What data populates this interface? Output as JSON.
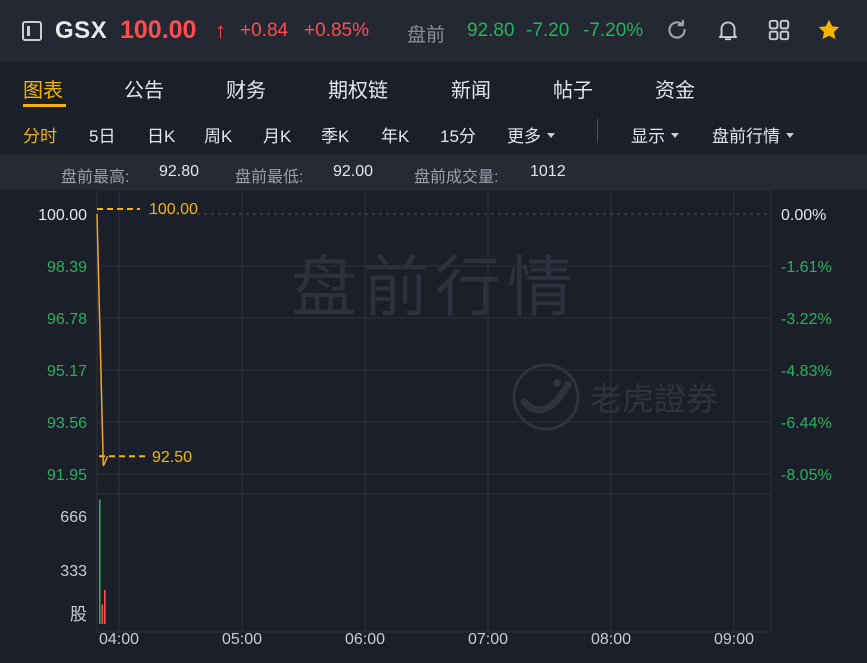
{
  "header": {
    "ticker": "GSX",
    "price": "100.00",
    "price_arrow": "↑",
    "change": "+0.84",
    "change_pct": "+0.85%",
    "premarket_label": "盘前",
    "premarket_price": "92.80",
    "premarket_change": "-7.20",
    "premarket_change_pct": "-7.20%",
    "icons": [
      "sidebar-toggle-icon",
      "refresh-icon",
      "bell-icon",
      "grid-icon",
      "star-icon"
    ]
  },
  "tabs": [
    {
      "label": "图表",
      "active": true
    },
    {
      "label": "公告"
    },
    {
      "label": "财务"
    },
    {
      "label": "期权链"
    },
    {
      "label": "新闻"
    },
    {
      "label": "帖子"
    },
    {
      "label": "资金"
    }
  ],
  "periods": [
    {
      "label": "分时",
      "active": true
    },
    {
      "label": "5日"
    },
    {
      "label": "日K"
    },
    {
      "label": "周K"
    },
    {
      "label": "月K"
    },
    {
      "label": "季K"
    },
    {
      "label": "年K"
    },
    {
      "label": "15分"
    },
    {
      "label": "更多"
    }
  ],
  "display_dropdown": "显示",
  "session_dropdown": "盘前行情",
  "info": {
    "high_label": "盘前最高:",
    "high_value": "92.80",
    "low_label": "盘前最低:",
    "low_value": "92.00",
    "volume_label": "盘前成交量:",
    "volume_value": "1012"
  },
  "watermark": {
    "text": "盘前行情",
    "brand": "老虎證券"
  },
  "colors": {
    "up": "#ff4d4f",
    "down": "#24b35b",
    "accent": "#f4b400",
    "price_line": "#f5a623"
  },
  "chart_data": {
    "type": "line",
    "y_ticks": [
      "100.00",
      "98.39",
      "96.78",
      "95.17",
      "93.56",
      "91.95"
    ],
    "pct_ticks": [
      "0.00%",
      "-1.61%",
      "-3.22%",
      "-4.83%",
      "-6.44%",
      "-8.05%"
    ],
    "ylim": [
      91.95,
      100.0
    ],
    "x_ticks": [
      "04:00",
      "05:00",
      "06:00",
      "07:00",
      "08:00",
      "09:00"
    ],
    "reference_line": {
      "label": "100.00",
      "value": 100.0
    },
    "last_price_line": {
      "label": "92.50",
      "value": 92.5
    },
    "series": [
      {
        "x": [
          "04:00",
          "04:02",
          "04:03"
        ],
        "values": [
          100.0,
          92.2,
          92.5
        ]
      }
    ],
    "volume": {
      "ticks": [
        "666",
        "333"
      ],
      "unit_label": "股",
      "ylim": [
        0,
        800
      ],
      "bars": [
        {
          "x": "04:01",
          "value": 766,
          "direction": "down"
        },
        {
          "x": "04:02",
          "value": 120,
          "direction": "up"
        },
        {
          "x": "04:03",
          "value": 210,
          "direction": "up"
        }
      ]
    }
  }
}
